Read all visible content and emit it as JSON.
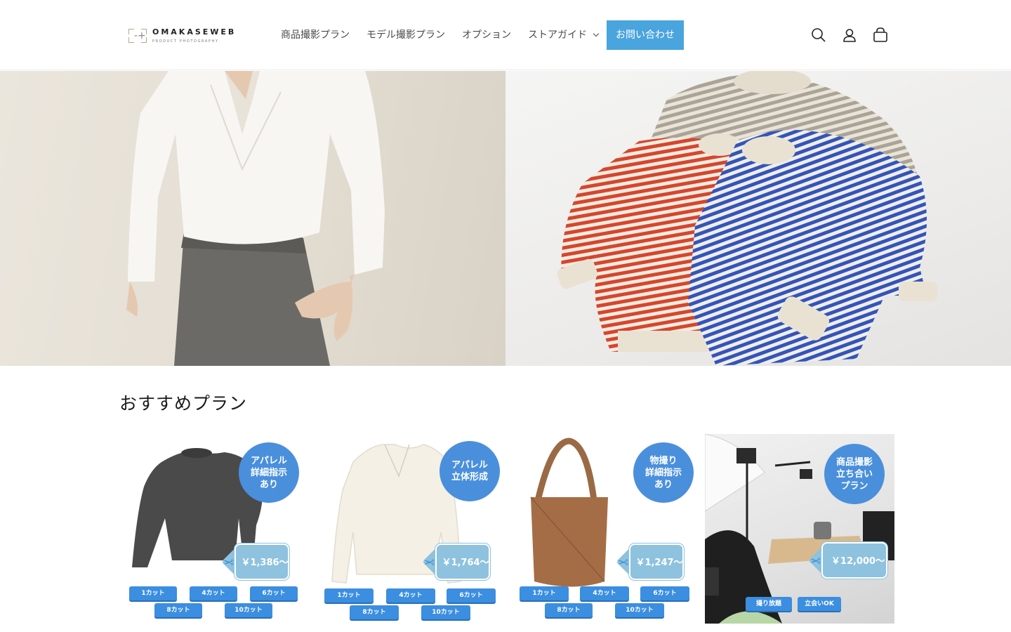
{
  "header": {
    "logo": {
      "name": "OMAKASEWEB",
      "sub": "PRODUCT PHOTOGRAPHY"
    },
    "nav": [
      {
        "label": "商品撮影プラン"
      },
      {
        "label": "モデル撮影プラン"
      },
      {
        "label": "オプション"
      },
      {
        "label": "ストアガイド"
      }
    ],
    "cta_label": "お問い合わせ",
    "icons": [
      "search-icon",
      "account-icon",
      "cart-icon"
    ]
  },
  "hero": {
    "left_image": "model-white-blouse-gray-skirt",
    "right_image": "striped-sweaters-flatlay"
  },
  "section": {
    "title": "おすすめプラン",
    "cards": [
      {
        "image": "gray-knit-sweater",
        "badge": "アパレル\n詳細指示\nあり",
        "price": "￥1,386〜",
        "pills": [
          "1カット",
          "4カット",
          "6カット",
          "8カット",
          "10カット"
        ]
      },
      {
        "image": "cream-blouse",
        "badge": "アパレル\n立体形成",
        "price": "￥1,764〜",
        "pills": [
          "1カット",
          "4カット",
          "6カット",
          "8カット",
          "10カット"
        ]
      },
      {
        "image": "brown-leather-bag",
        "badge": "物撮り\n詳細指示\nあり",
        "price": "￥1,247〜",
        "pills": [
          "1カット",
          "4カット",
          "6カット",
          "8カット",
          "10カット"
        ]
      },
      {
        "image": "studio-photo-session",
        "badge": "商品撮影\n立ち合い\nプラン",
        "price": "￥12,000〜",
        "pills": [
          "撮り放題",
          "立会いOK"
        ]
      }
    ]
  },
  "colors": {
    "accent": "#4aa4dd",
    "badge": "#4a8fdc",
    "tag": "#8ec2df",
    "pill": "#3b8ee0"
  }
}
